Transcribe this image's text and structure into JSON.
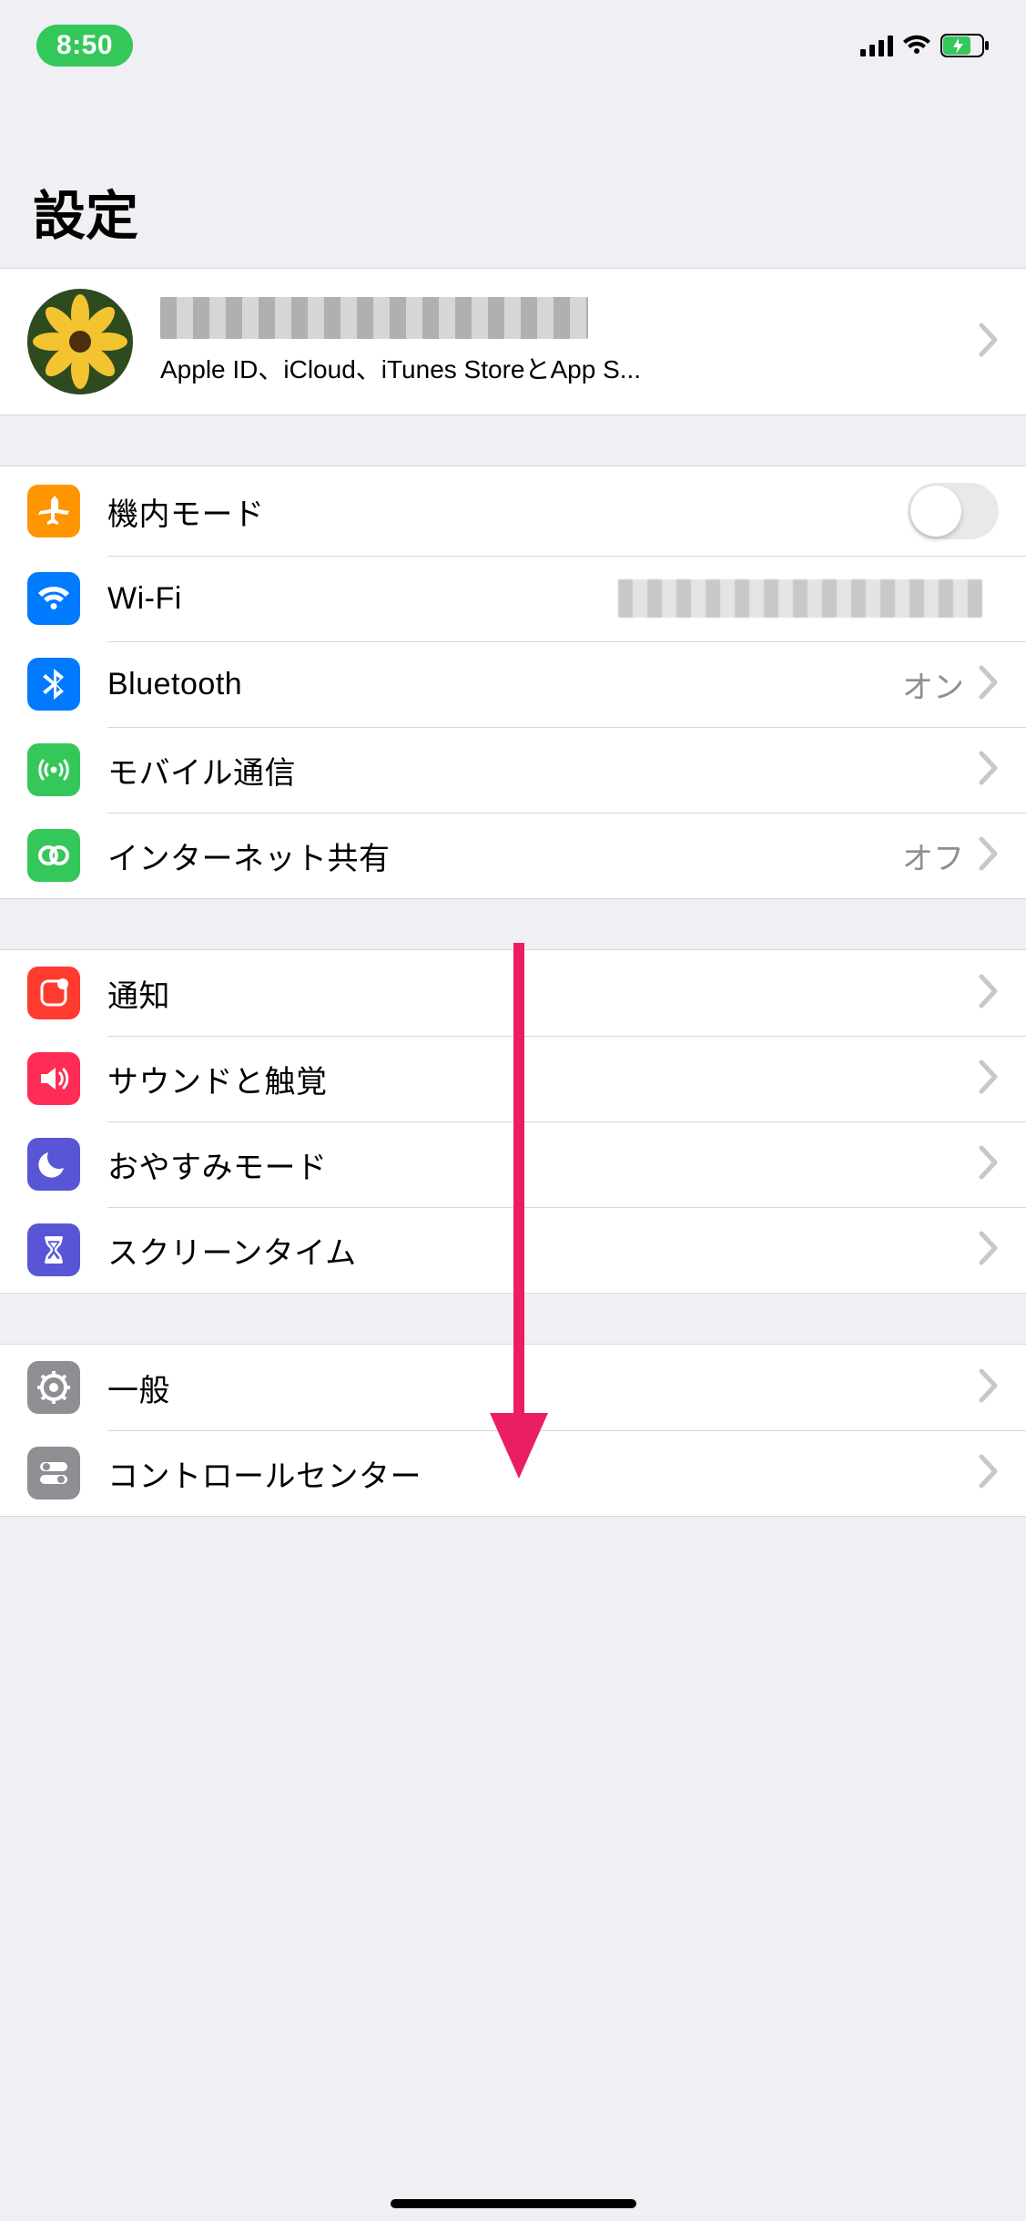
{
  "status": {
    "time": "8:50"
  },
  "title": "設定",
  "profile": {
    "subtitle": "Apple ID、iCloud、iTunes StoreとApp S..."
  },
  "groups": [
    {
      "items": [
        {
          "id": "airplane",
          "label": "機内モード",
          "value": "",
          "switch": true,
          "chevron": false,
          "icon": "airplane",
          "bg": "bg-orange"
        },
        {
          "id": "wifi",
          "label": "Wi-Fi",
          "value": "",
          "switch": false,
          "chevron": false,
          "icon": "wifi",
          "bg": "bg-blue",
          "pixelValue": true
        },
        {
          "id": "bt",
          "label": "Bluetooth",
          "value": "オン",
          "switch": false,
          "chevron": true,
          "icon": "bluetooth",
          "bg": "bg-btblue"
        },
        {
          "id": "cellular",
          "label": "モバイル通信",
          "value": "",
          "switch": false,
          "chevron": true,
          "icon": "antenna",
          "bg": "bg-green"
        },
        {
          "id": "hotspot",
          "label": "インターネット共有",
          "value": "オフ",
          "switch": false,
          "chevron": true,
          "icon": "link",
          "bg": "bg-green2"
        }
      ]
    },
    {
      "items": [
        {
          "id": "notify",
          "label": "通知",
          "value": "",
          "switch": false,
          "chevron": true,
          "icon": "notify",
          "bg": "bg-red"
        },
        {
          "id": "sound",
          "label": "サウンドと触覚",
          "value": "",
          "switch": false,
          "chevron": true,
          "icon": "sound",
          "bg": "bg-pink"
        },
        {
          "id": "dnd",
          "label": "おやすみモード",
          "value": "",
          "switch": false,
          "chevron": true,
          "icon": "moon",
          "bg": "bg-purple"
        },
        {
          "id": "screen",
          "label": "スクリーンタイム",
          "value": "",
          "switch": false,
          "chevron": true,
          "icon": "hourglass",
          "bg": "bg-indigo"
        }
      ]
    },
    {
      "items": [
        {
          "id": "general",
          "label": "一般",
          "value": "",
          "switch": false,
          "chevron": true,
          "icon": "gear",
          "bg": "bg-gray"
        },
        {
          "id": "control",
          "label": "コントロールセンター",
          "value": "",
          "switch": false,
          "chevron": true,
          "icon": "toggle",
          "bg": "bg-gray"
        }
      ]
    }
  ]
}
